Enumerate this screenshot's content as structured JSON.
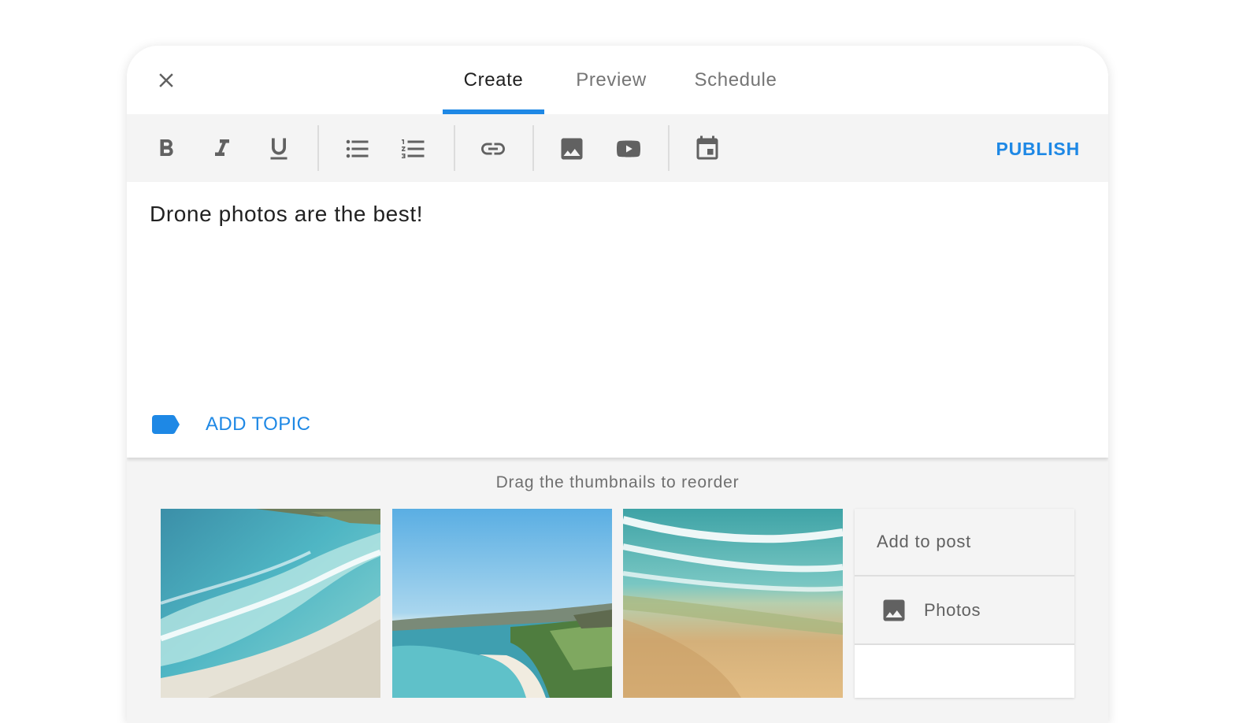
{
  "tabs": [
    {
      "label": "Create",
      "active": true
    },
    {
      "label": "Preview",
      "active": false
    },
    {
      "label": "Schedule",
      "active": false
    }
  ],
  "toolbar": {
    "icons": [
      "bold-icon",
      "italic-icon",
      "underline-icon",
      "bulleted-list-icon",
      "numbered-list-icon",
      "link-icon",
      "image-icon",
      "video-icon",
      "calendar-icon"
    ],
    "publish_label": "PUBLISH"
  },
  "editor": {
    "text": "Drone photos are the best!",
    "add_topic_label": "ADD TOPIC"
  },
  "media": {
    "hint": "Drag the thumbnails to reorder",
    "add_panel": {
      "title": "Add to post",
      "items": [
        {
          "label": "Photos",
          "icon": "image-icon"
        }
      ]
    }
  },
  "colors": {
    "accent": "#1e88e5",
    "icon": "#616161",
    "toolbar_bg": "#f4f4f4"
  }
}
